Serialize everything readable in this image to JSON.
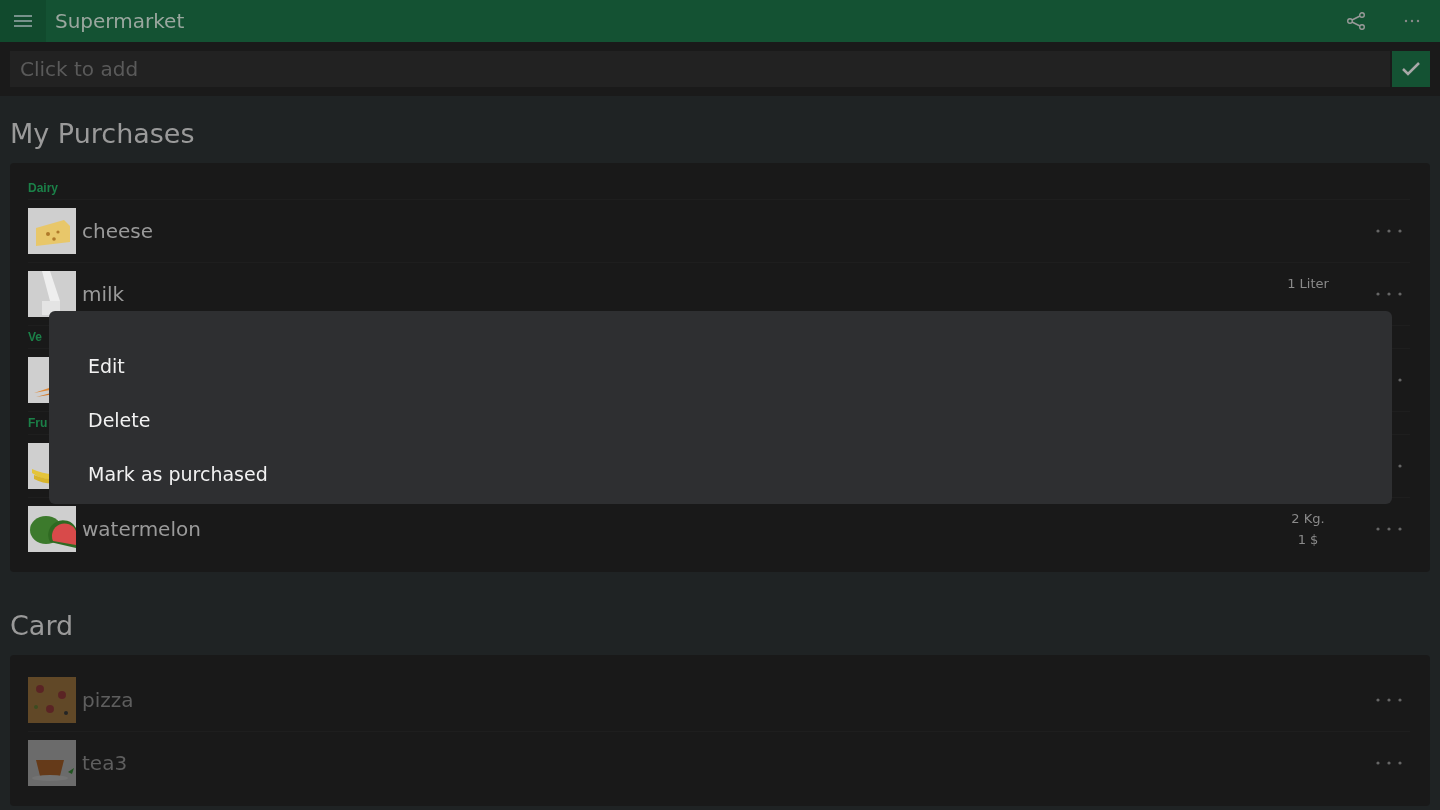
{
  "app_bar": {
    "title": "Supermarket"
  },
  "add_field": {
    "placeholder": "Click to add"
  },
  "sections": [
    {
      "title": "My Purchases",
      "groups": [
        {
          "label": "Dairy",
          "items": [
            {
              "name": "cheese",
              "purchased": false
            },
            {
              "name": "milk",
              "quantity": "1 Liter",
              "purchased": false
            }
          ]
        },
        {
          "label": "Ve",
          "items": [
            {
              "purchased": false
            }
          ]
        },
        {
          "label": "Fru",
          "items": [
            {
              "purchased": false
            },
            {
              "name": "watermelon",
              "quantity": "2 Kg.",
              "price": "1 $",
              "purchased": false
            }
          ]
        }
      ]
    },
    {
      "title": "Card",
      "groups": [
        {
          "items": [
            {
              "name": "pizza",
              "purchased": true
            },
            {
              "name": "tea3",
              "purchased": true
            }
          ]
        }
      ]
    }
  ],
  "context_menu": {
    "items": [
      "Edit",
      "Delete",
      "Mark as purchased"
    ]
  }
}
